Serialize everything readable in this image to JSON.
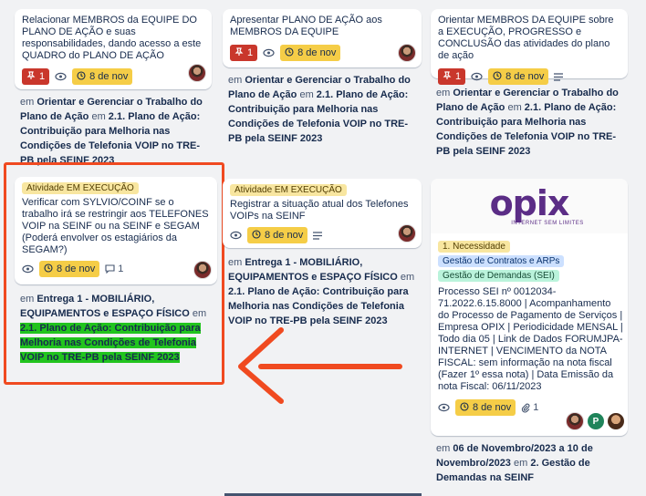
{
  "col1": {
    "card1": {
      "title": "Relacionar MEMBROS da EQUIPE DO PLANO DE AÇÃO e suas responsabilidades, dando acesso a este QUADRO do PLANO DE AÇÃO",
      "priority_count": "1",
      "due": "8 de nov"
    },
    "sub1": {
      "prefix": "em ",
      "link": "Orientar e Gerenciar o Trabalho do Plano de Ação",
      "mid": " em ",
      "list": "2.1. Plano de Ação: Contribuição para Melhoria nas Condições de Telefonia VOIP no TRE-PB pela SEINF 2023"
    },
    "card2": {
      "label": "Atividade EM EXECUÇÃO",
      "title": "Verificar com SYLVIO/COINF se o trabalho irá se restringir aos TELEFONES VOIP na SEINF ou na SEINF e SEGAM (Poderá envolver os estagiários da SEGAM?)",
      "due": "8 de nov",
      "comments": "1"
    },
    "sub2": {
      "prefix": "em ",
      "link": "Entrega 1 - MOBILIÁRIO, EQUIPAMENTOS e ESPAÇO FÍSICO",
      "mid": " em ",
      "list": "2.1. Plano de Ação: Contribuição para Melhoria nas Condições de Telefonia VOIP no TRE-PB pela SEINF 2023"
    }
  },
  "col2": {
    "card1": {
      "title": "Apresentar PLANO DE AÇÃO aos MEMBROS DA EQUIPE",
      "priority_count": "1",
      "due": "8 de nov"
    },
    "sub1": {
      "prefix": "em ",
      "link": "Orientar e Gerenciar o Trabalho do Plano de Ação",
      "mid": " em ",
      "list": "2.1. Plano de Ação: Contribuição para Melhoria nas Condições de Telefonia VOIP no TRE-PB pela SEINF 2023"
    },
    "card2": {
      "label": "Atividade EM EXECUÇÃO",
      "title": "Registrar a situação atual dos Telefones VOIPs na SEINF",
      "due": "8 de nov"
    },
    "sub2": {
      "prefix": "em ",
      "link": "Entrega 1 - MOBILIÁRIO, EQUIPAMENTOS e ESPAÇO FÍSICO",
      "mid": " em ",
      "list": "2.1. Plano de Ação: Contribuição para Melhoria nas Condições de Telefonia VOIP no TRE-PB pela SEINF 2023"
    }
  },
  "col3": {
    "card1": {
      "title": "Orientar MEMBROS DA EQUIPE sobre a EXECUÇÃO, PROGRESSO e CONCLUSÃO das atividades do plano de ação",
      "priority_count": "1",
      "due": "8 de nov"
    },
    "sub1": {
      "prefix": "em ",
      "link": "Orientar e Gerenciar o Trabalho do Plano de Ação",
      "mid": " em ",
      "list": "2.1. Plano de Ação: Contribuição para Melhoria nas Condições de Telefonia VOIP no TRE-PB pela SEINF 2023"
    },
    "card2": {
      "logo": "opix",
      "logo_sub": "INTERNET SEM LIMITES",
      "labels": [
        "1. Necessidade",
        "Gestão de Contratos e ARPs",
        "Gestão de Demandas (SEI)"
      ],
      "title": "Processo SEI nº 0012034-71.2022.6.15.8000 | Acompanhamento do Processo de Pagamento de Serviços | Empresa OPIX | Periodicidade MENSAL | Todo dia 05 | Link de Dados FORUMJPA-INTERNET | VENCIMENTO da NOTA FISCAL: sem informação na nota fiscal (Fazer 1º essa nota) | Data Emissão da nota Fiscal: 06/11/2023",
      "due": "8 de nov",
      "attachments": "1",
      "avatar_letter": "P"
    },
    "sub2": {
      "prefix": "em ",
      "link": "06 de Novembro/2023 a 10 de Novembro/2023",
      "mid": " em ",
      "list": "2. Gestão de Demandas na SEINF"
    }
  },
  "colors": {
    "highlight": "#22c41e",
    "annotation": "#f04a20",
    "due_badge": "#f5cd47",
    "priority_badge": "#c9372c"
  }
}
